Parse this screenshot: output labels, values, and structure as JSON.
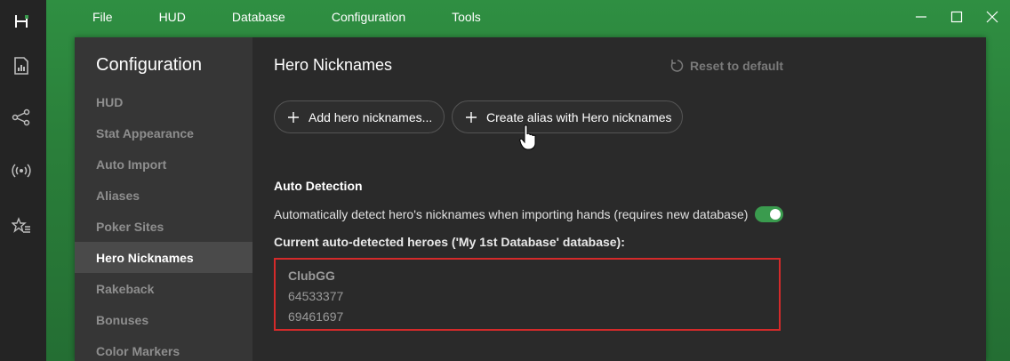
{
  "menu": [
    "File",
    "HUD",
    "Database",
    "Configuration",
    "Tools"
  ],
  "rail_icons": [
    "app-logo-icon",
    "reports-icon",
    "share-icon",
    "broadcast-icon",
    "favorites-icon"
  ],
  "sidebar": {
    "title": "Configuration",
    "items": [
      {
        "label": "HUD",
        "active": false
      },
      {
        "label": "Stat Appearance",
        "active": false
      },
      {
        "label": "Auto Import",
        "active": false
      },
      {
        "label": "Aliases",
        "active": false
      },
      {
        "label": "Poker Sites",
        "active": false
      },
      {
        "label": "Hero Nicknames",
        "active": true
      },
      {
        "label": "Rakeback",
        "active": false
      },
      {
        "label": "Bonuses",
        "active": false
      },
      {
        "label": "Color Markers",
        "active": false
      }
    ]
  },
  "main": {
    "title": "Hero Nicknames",
    "reset_label": "Reset to default",
    "add_button": "Add hero nicknames...",
    "alias_button": "Create alias with Hero nicknames",
    "section_title": "Auto Detection",
    "auto_detect_text": "Automatically detect hero's nicknames when importing hands (requires new database)",
    "auto_detect_enabled": true,
    "current_label": "Current auto-detected heroes ('My 1st Database' database):",
    "heroes": {
      "site": "ClubGG",
      "ids": [
        "64533377",
        "69461697"
      ]
    }
  },
  "colors": {
    "accent_green": "#3a9b4e",
    "highlight_border": "#d42a2a",
    "background_green": "#2b8a3e"
  }
}
